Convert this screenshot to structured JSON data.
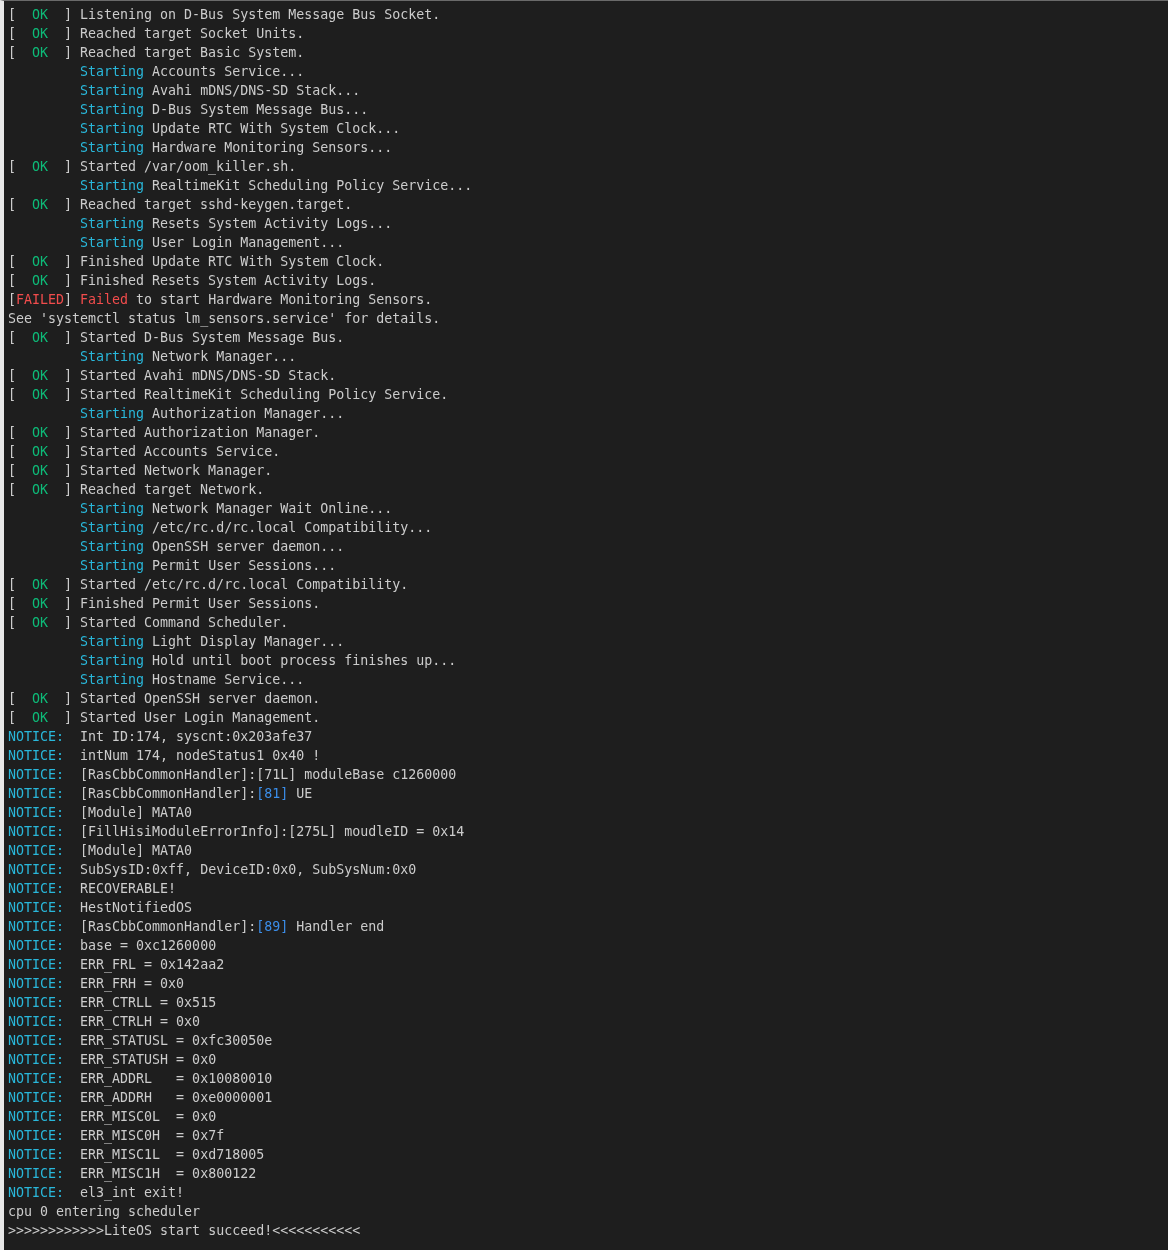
{
  "lines": [
    {
      "kind": "status",
      "failed": false,
      "open": "[",
      "label": "OK",
      "close": "]",
      "parts": [
        {
          "text": "Listening on D-Bus System Message Bus Socket.",
          "kind": "plain"
        }
      ]
    },
    {
      "kind": "status",
      "failed": false,
      "open": "[",
      "label": "OK",
      "close": "]",
      "parts": [
        {
          "text": "Reached target Socket Units.",
          "kind": "plain"
        }
      ]
    },
    {
      "kind": "status",
      "failed": false,
      "open": "[",
      "label": "OK",
      "close": "]",
      "parts": [
        {
          "text": "Reached target Basic System.",
          "kind": "plain"
        }
      ]
    },
    {
      "kind": "job",
      "verb": "Starting",
      "parts": [
        {
          "text": "Accounts Service...",
          "kind": "plain"
        }
      ]
    },
    {
      "kind": "job",
      "verb": "Starting",
      "parts": [
        {
          "text": "Avahi mDNS/DNS-SD Stack...",
          "kind": "plain"
        }
      ]
    },
    {
      "kind": "job",
      "verb": "Starting",
      "parts": [
        {
          "text": "D-Bus System Message Bus...",
          "kind": "plain"
        }
      ]
    },
    {
      "kind": "job",
      "verb": "Starting",
      "parts": [
        {
          "text": "Update RTC With System Clock...",
          "kind": "plain"
        }
      ]
    },
    {
      "kind": "job",
      "verb": "Starting",
      "parts": [
        {
          "text": "Hardware Monitoring Sensors...",
          "kind": "plain"
        }
      ]
    },
    {
      "kind": "status",
      "failed": false,
      "open": "[",
      "label": "OK",
      "close": "]",
      "parts": [
        {
          "text": "Started /var/oom_killer.sh.",
          "kind": "plain"
        }
      ]
    },
    {
      "kind": "job",
      "verb": "Starting",
      "parts": [
        {
          "text": "RealtimeKit Scheduling Policy Service...",
          "kind": "plain"
        }
      ]
    },
    {
      "kind": "status",
      "failed": false,
      "open": "[",
      "label": "OK",
      "close": "]",
      "parts": [
        {
          "text": "Reached target sshd-keygen.target.",
          "kind": "plain"
        }
      ]
    },
    {
      "kind": "job",
      "verb": "Starting",
      "parts": [
        {
          "text": "Resets System Activity Logs...",
          "kind": "plain"
        }
      ]
    },
    {
      "kind": "job",
      "verb": "Starting",
      "parts": [
        {
          "text": "User Login Management...",
          "kind": "plain"
        }
      ]
    },
    {
      "kind": "status",
      "failed": false,
      "open": "[",
      "label": "OK",
      "close": "]",
      "parts": [
        {
          "text": "Finished Update RTC With System Clock.",
          "kind": "plain"
        }
      ]
    },
    {
      "kind": "status",
      "failed": false,
      "open": "[",
      "label": "OK",
      "close": "]",
      "parts": [
        {
          "text": "Finished Resets System Activity Logs.",
          "kind": "plain"
        }
      ]
    },
    {
      "kind": "status",
      "failed": true,
      "open": "[",
      "label": "FAILED",
      "close": "]",
      "parts": [
        {
          "text": "Failed",
          "kind": "failed"
        },
        {
          "text": " to start Hardware Monitoring Sensors.",
          "kind": "plain"
        }
      ]
    },
    {
      "kind": "plain",
      "parts": [
        {
          "text": "See 'systemctl status lm_sensors.service' for details.",
          "kind": "plain"
        }
      ]
    },
    {
      "kind": "status",
      "failed": false,
      "open": "[",
      "label": "OK",
      "close": "]",
      "parts": [
        {
          "text": "Started D-Bus System Message Bus.",
          "kind": "plain"
        }
      ]
    },
    {
      "kind": "job",
      "verb": "Starting",
      "parts": [
        {
          "text": "Network Manager...",
          "kind": "plain"
        }
      ]
    },
    {
      "kind": "status",
      "failed": false,
      "open": "[",
      "label": "OK",
      "close": "]",
      "parts": [
        {
          "text": "Started Avahi mDNS/DNS-SD Stack.",
          "kind": "plain"
        }
      ]
    },
    {
      "kind": "status",
      "failed": false,
      "open": "[",
      "label": "OK",
      "close": "]",
      "parts": [
        {
          "text": "Started RealtimeKit Scheduling Policy Service.",
          "kind": "plain"
        }
      ]
    },
    {
      "kind": "job",
      "verb": "Starting",
      "parts": [
        {
          "text": "Authorization Manager...",
          "kind": "plain"
        }
      ]
    },
    {
      "kind": "status",
      "failed": false,
      "open": "[",
      "label": "OK",
      "close": "]",
      "parts": [
        {
          "text": "Started Authorization Manager.",
          "kind": "plain"
        }
      ]
    },
    {
      "kind": "status",
      "failed": false,
      "open": "[",
      "label": "OK",
      "close": "]",
      "parts": [
        {
          "text": "Started Accounts Service.",
          "kind": "plain"
        }
      ]
    },
    {
      "kind": "status",
      "failed": false,
      "open": "[",
      "label": "OK",
      "close": "]",
      "parts": [
        {
          "text": "Started Network Manager.",
          "kind": "plain"
        }
      ]
    },
    {
      "kind": "status",
      "failed": false,
      "open": "[",
      "label": "OK",
      "close": "]",
      "parts": [
        {
          "text": "Reached target Network.",
          "kind": "plain"
        }
      ]
    },
    {
      "kind": "job",
      "verb": "Starting",
      "parts": [
        {
          "text": "Network Manager Wait Online...",
          "kind": "plain"
        }
      ]
    },
    {
      "kind": "job",
      "verb": "Starting",
      "parts": [
        {
          "text": "/etc/rc.d/rc.local Compatibility...",
          "kind": "plain"
        }
      ]
    },
    {
      "kind": "job",
      "verb": "Starting",
      "parts": [
        {
          "text": "OpenSSH server daemon...",
          "kind": "plain"
        }
      ]
    },
    {
      "kind": "job",
      "verb": "Starting",
      "parts": [
        {
          "text": "Permit User Sessions...",
          "kind": "plain"
        }
      ]
    },
    {
      "kind": "status",
      "failed": false,
      "open": "[",
      "label": "OK",
      "close": "]",
      "parts": [
        {
          "text": "Started /etc/rc.d/rc.local Compatibility.",
          "kind": "plain"
        }
      ]
    },
    {
      "kind": "status",
      "failed": false,
      "open": "[",
      "label": "OK",
      "close": "]",
      "parts": [
        {
          "text": "Finished Permit User Sessions.",
          "kind": "plain"
        }
      ]
    },
    {
      "kind": "status",
      "failed": false,
      "open": "[",
      "label": "OK",
      "close": "]",
      "parts": [
        {
          "text": "Started Command Scheduler.",
          "kind": "plain"
        }
      ]
    },
    {
      "kind": "job",
      "verb": "Starting",
      "parts": [
        {
          "text": "Light Display Manager...",
          "kind": "plain"
        }
      ]
    },
    {
      "kind": "job",
      "verb": "Starting",
      "parts": [
        {
          "text": "Hold until boot process finishes up...",
          "kind": "plain"
        }
      ]
    },
    {
      "kind": "job",
      "verb": "Starting",
      "parts": [
        {
          "text": "Hostname Service...",
          "kind": "plain"
        }
      ]
    },
    {
      "kind": "status",
      "failed": false,
      "open": "[",
      "label": "OK",
      "close": "]",
      "parts": [
        {
          "text": "Started OpenSSH server daemon.",
          "kind": "plain"
        }
      ]
    },
    {
      "kind": "status",
      "failed": false,
      "open": "[",
      "label": "OK",
      "close": "]",
      "parts": [
        {
          "text": "Started User Login Management.",
          "kind": "plain"
        }
      ]
    },
    {
      "kind": "notice",
      "tag": "NOTICE:",
      "parts": [
        {
          "text": "Int ID:174, syscnt:0x203afe37",
          "kind": "plain"
        }
      ]
    },
    {
      "kind": "notice",
      "tag": "NOTICE:",
      "parts": [
        {
          "text": "intNum 174, nodeStatus1 0x40 !",
          "kind": "plain"
        }
      ]
    },
    {
      "kind": "notice",
      "tag": "NOTICE:",
      "parts": [
        {
          "text": "[RasCbbCommonHandler]:[71L] moduleBase c1260000",
          "kind": "plain"
        }
      ]
    },
    {
      "kind": "notice",
      "tag": "NOTICE:",
      "parts": [
        {
          "text": "[RasCbbCommonHandler]:",
          "kind": "plain"
        },
        {
          "text": "[81]",
          "kind": "ref"
        },
        {
          "text": " UE",
          "kind": "plain"
        }
      ]
    },
    {
      "kind": "notice",
      "tag": "NOTICE:",
      "parts": [
        {
          "text": "[Module] MATA0",
          "kind": "plain"
        }
      ]
    },
    {
      "kind": "notice",
      "tag": "NOTICE:",
      "parts": [
        {
          "text": "[FillHisiModuleErrorInfo]:[275L] moudleID = 0x14",
          "kind": "plain"
        }
      ]
    },
    {
      "kind": "notice",
      "tag": "NOTICE:",
      "parts": [
        {
          "text": "[Module] MATA0",
          "kind": "plain"
        }
      ]
    },
    {
      "kind": "notice",
      "tag": "NOTICE:",
      "parts": [
        {
          "text": "SubSysID:0xff, DeviceID:0x0, SubSysNum:0x0",
          "kind": "plain"
        }
      ]
    },
    {
      "kind": "notice",
      "tag": "NOTICE:",
      "parts": [
        {
          "text": "RECOVERABLE!",
          "kind": "plain"
        }
      ]
    },
    {
      "kind": "notice",
      "tag": "NOTICE:",
      "parts": [
        {
          "text": "HestNotifiedOS",
          "kind": "plain"
        }
      ]
    },
    {
      "kind": "notice",
      "tag": "NOTICE:",
      "parts": [
        {
          "text": "[RasCbbCommonHandler]:",
          "kind": "plain"
        },
        {
          "text": "[89]",
          "kind": "ref"
        },
        {
          "text": " Handler end",
          "kind": "plain"
        }
      ]
    },
    {
      "kind": "notice",
      "tag": "NOTICE:",
      "parts": [
        {
          "text": "base = 0xc1260000",
          "kind": "plain"
        }
      ]
    },
    {
      "kind": "notice",
      "tag": "NOTICE:",
      "parts": [
        {
          "text": "ERR_FRL = 0x142aa2",
          "kind": "plain"
        }
      ]
    },
    {
      "kind": "notice",
      "tag": "NOTICE:",
      "parts": [
        {
          "text": "ERR_FRH = 0x0",
          "kind": "plain"
        }
      ]
    },
    {
      "kind": "notice",
      "tag": "NOTICE:",
      "parts": [
        {
          "text": "ERR_CTRLL = 0x515",
          "kind": "plain"
        }
      ]
    },
    {
      "kind": "notice",
      "tag": "NOTICE:",
      "parts": [
        {
          "text": "ERR_CTRLH = 0x0",
          "kind": "plain"
        }
      ]
    },
    {
      "kind": "notice",
      "tag": "NOTICE:",
      "parts": [
        {
          "text": "ERR_STATUSL = 0xfc30050e",
          "kind": "plain"
        }
      ]
    },
    {
      "kind": "notice",
      "tag": "NOTICE:",
      "parts": [
        {
          "text": "ERR_STATUSH = 0x0",
          "kind": "plain"
        }
      ]
    },
    {
      "kind": "notice",
      "tag": "NOTICE:",
      "parts": [
        {
          "text": "ERR_ADDRL   = 0x10080010",
          "kind": "plain"
        }
      ]
    },
    {
      "kind": "notice",
      "tag": "NOTICE:",
      "parts": [
        {
          "text": "ERR_ADDRH   = 0xe0000001",
          "kind": "plain"
        }
      ]
    },
    {
      "kind": "notice",
      "tag": "NOTICE:",
      "parts": [
        {
          "text": "ERR_MISC0L  = 0x0",
          "kind": "plain"
        }
      ]
    },
    {
      "kind": "notice",
      "tag": "NOTICE:",
      "parts": [
        {
          "text": "ERR_MISC0H  = 0x7f",
          "kind": "plain"
        }
      ]
    },
    {
      "kind": "notice",
      "tag": "NOTICE:",
      "parts": [
        {
          "text": "ERR_MISC1L  = 0xd718005",
          "kind": "plain"
        }
      ]
    },
    {
      "kind": "notice",
      "tag": "NOTICE:",
      "parts": [
        {
          "text": "ERR_MISC1H  = 0x800122",
          "kind": "plain"
        }
      ]
    },
    {
      "kind": "notice",
      "tag": "NOTICE:",
      "parts": [
        {
          "text": "el3_int exit!",
          "kind": "plain"
        }
      ]
    },
    {
      "kind": "plain",
      "parts": [
        {
          "text": "cpu 0 entering scheduler",
          "kind": "plain"
        }
      ]
    },
    {
      "kind": "plain",
      "parts": [
        {
          "text": ">>>>>>>>>>>>LiteOS start succeed!<<<<<<<<<<<",
          "kind": "plain"
        }
      ]
    }
  ]
}
